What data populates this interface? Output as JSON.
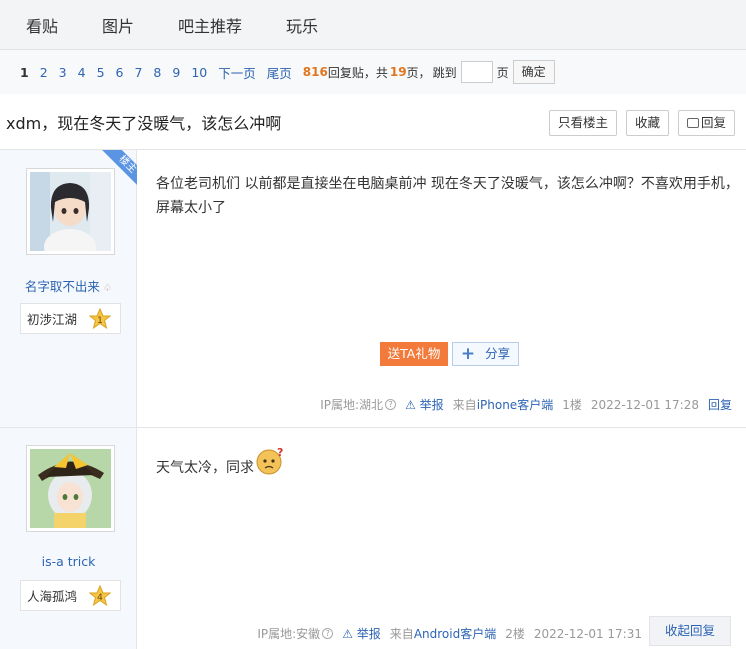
{
  "nav": {
    "tabs": [
      "看贴",
      "图片",
      "吧主推荐",
      "玩乐"
    ]
  },
  "pager": {
    "current": "1",
    "pages": [
      "2",
      "3",
      "4",
      "5",
      "6",
      "7",
      "8",
      "9",
      "10"
    ],
    "next": "下一页",
    "last": "尾页",
    "reply_count": "816",
    "reply_label": "回复贴，共",
    "total_pages": "19",
    "page_suffix": "页，",
    "jump_label": "跳到",
    "jump_suffix": "页",
    "confirm": "确定"
  },
  "thread": {
    "title": "xdm，现在冬天了没暖气，该怎么冲啊",
    "only_op": "只看楼主",
    "favorite": "收藏",
    "reply": "回复"
  },
  "posts": [
    {
      "user": "名字取不出来",
      "level_title": "初涉江湖",
      "level": "1",
      "op_badge": "楼主",
      "content": "各位老司机们 以前都是直接坐在电脑桌前冲 现在冬天了没暖气，该怎么冲啊？不喜欢用手机，屏幕太小了",
      "gift": "送TA礼物",
      "share": "分享",
      "ip": "IP属地:湖北",
      "report": "举报",
      "source_prefix": "来自",
      "source": "iPhone客户端",
      "floor": "1楼",
      "time": "2022-12-01 17:28",
      "reply": "回复"
    },
    {
      "user": "is-a trick",
      "level_title": "人海孤鸿",
      "level": "4",
      "content": "天气太冷，同求",
      "ip": "IP属地:安徽",
      "report": "举报",
      "source_prefix": "来自",
      "source": "Android客户端",
      "floor": "2楼",
      "time": "2022-12-01 17:31",
      "collapse": "收起回复"
    }
  ],
  "colors": {
    "accent_blue": "#2d64b3",
    "orange": "#e1761e",
    "gift": "#f27a3b"
  }
}
